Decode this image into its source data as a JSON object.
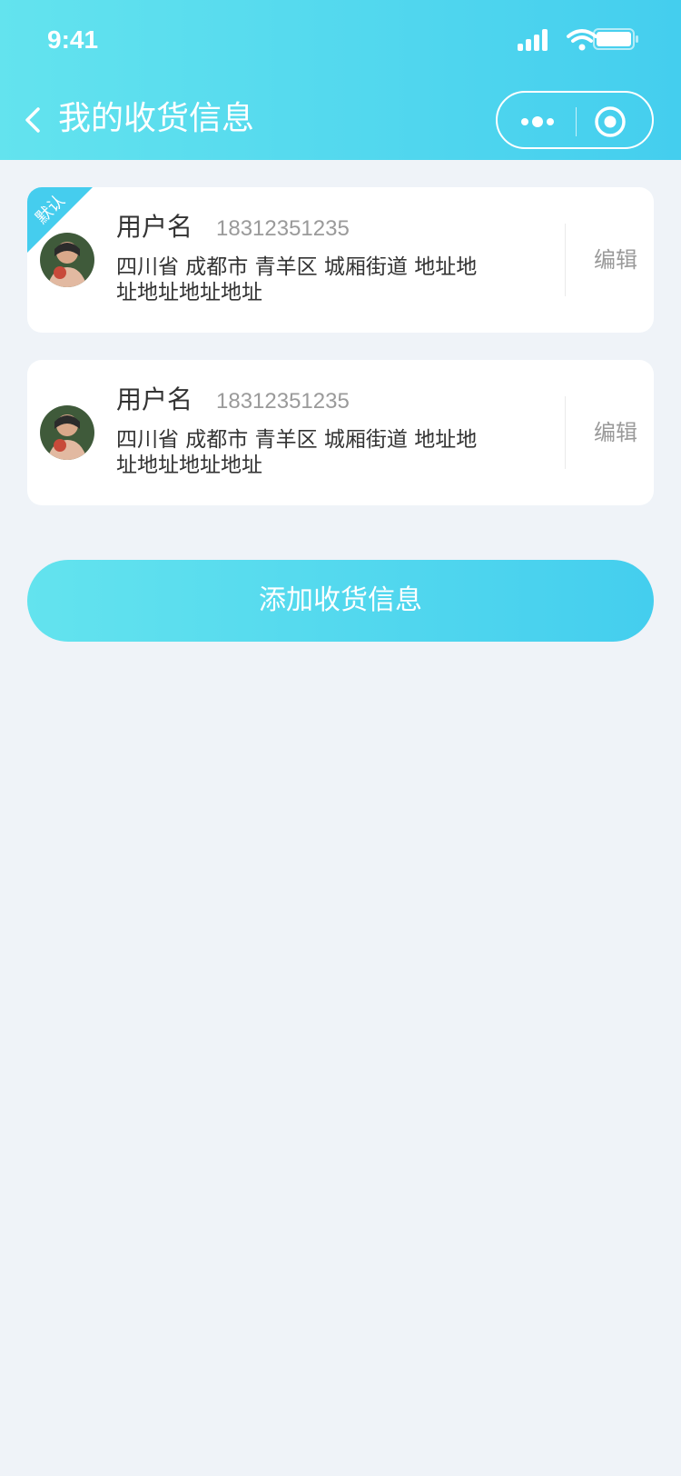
{
  "status_bar": {
    "time": "9:41"
  },
  "nav": {
    "title": "我的收货信息",
    "icons": [
      "back-icon",
      "more-icon",
      "close-mini-icon"
    ]
  },
  "colors": {
    "accent_start": "#63e3ee",
    "accent_end": "#44ceee",
    "background": "#eff3f8"
  },
  "addresses": [
    {
      "is_default": true,
      "badge": "默认",
      "name": "用户名",
      "phone": "18312351235",
      "address": "四川省 成都市 青羊区 城厢街道 地址地址地址地址地址",
      "edit_label": "编辑"
    },
    {
      "is_default": false,
      "name": "用户名",
      "phone": "18312351235",
      "address": "四川省 成都市 青羊区 城厢街道 地址地址地址地址地址",
      "edit_label": "编辑"
    }
  ],
  "add_button": {
    "label": "添加收货信息"
  }
}
